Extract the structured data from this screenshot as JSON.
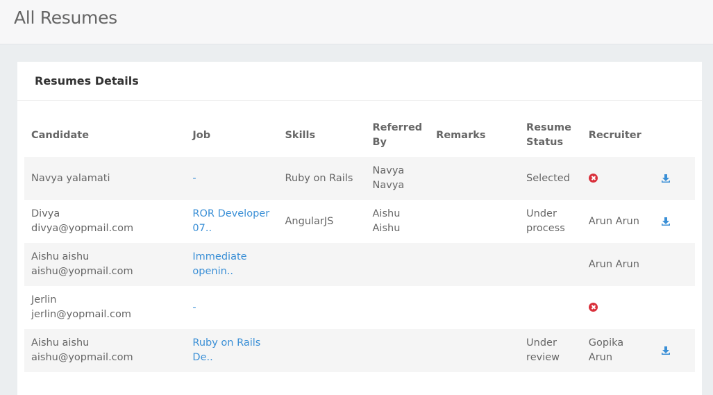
{
  "page": {
    "title": "All Resumes"
  },
  "card": {
    "title": "Resumes Details"
  },
  "table": {
    "headers": {
      "candidate": "Candidate",
      "job": "Job",
      "skills": "Skills",
      "referred_by": "Referred By",
      "remarks": "Remarks",
      "resume_status": "Resume Status",
      "recruiter": "Recruiter"
    },
    "rows": [
      {
        "name": "Navya yalamati",
        "email": "",
        "job": "-",
        "skills": "Ruby on Rails",
        "referred_by": "Navya Navya",
        "remarks": "",
        "status": "Selected",
        "recruiter": "",
        "recruiter_removed_icon": "times-circle-icon",
        "download_icon": "download-icon"
      },
      {
        "name": "Divya",
        "email": "divya@yopmail.com",
        "job": "ROR Developer 07..",
        "skills": "AngularJS",
        "referred_by": "Aishu Aishu",
        "remarks": "",
        "status": "Under process",
        "recruiter": "Arun Arun",
        "download_icon": "download-icon"
      },
      {
        "name": "Aishu aishu",
        "email": "aishu@yopmail.com",
        "job": "Immediate openin..",
        "skills": "",
        "referred_by": "",
        "remarks": "",
        "status": "",
        "recruiter": "Arun Arun"
      },
      {
        "name": "Jerlin",
        "email": "jerlin@yopmail.com",
        "job": "-",
        "skills": "",
        "referred_by": "",
        "remarks": "",
        "status": "",
        "recruiter": "",
        "recruiter_removed_icon": "times-circle-icon"
      },
      {
        "name": "Aishu aishu",
        "email": "aishu@yopmail.com",
        "job": "Ruby on Rails De..",
        "skills": "",
        "referred_by": "",
        "remarks": "",
        "status": "Under review",
        "recruiter": "Gopika Arun",
        "download_icon": "download-icon"
      }
    ]
  },
  "colors": {
    "link": "#3a8fd6",
    "reject": "#d9303b",
    "download": "#3a8fd6"
  }
}
